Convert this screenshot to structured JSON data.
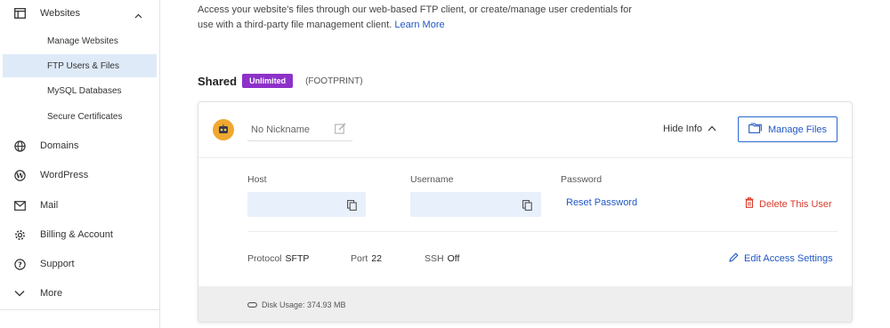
{
  "sidebar": {
    "section": {
      "label": "Websites",
      "icon": "websites-icon"
    },
    "sub_items": [
      {
        "label": "Manage Websites",
        "active": false
      },
      {
        "label": "FTP Users & Files",
        "active": true
      },
      {
        "label": "MySQL Databases",
        "active": false
      },
      {
        "label": "Secure Certificates",
        "active": false
      }
    ],
    "items": [
      {
        "label": "Domains",
        "icon": "globe-icon"
      },
      {
        "label": "WordPress",
        "icon": "wordpress-icon"
      },
      {
        "label": "Mail",
        "icon": "mail-icon"
      },
      {
        "label": "Billing & Account",
        "icon": "gear-icon"
      },
      {
        "label": "Support",
        "icon": "help-icon"
      },
      {
        "label": "More",
        "icon": "chevron-down-icon"
      }
    ]
  },
  "intro": {
    "text": "Access your website's files through our web-based FTP client, or create/manage user credentials for use with a third-party file management client.",
    "link": "Learn More"
  },
  "plan": {
    "title": "Shared",
    "badge": "Unlimited",
    "name": "(FOOTPRINT)"
  },
  "user": {
    "nickname_placeholder": "No Nickname",
    "hide_info": "Hide Info",
    "manage_files": "Manage Files",
    "host_label": "Host",
    "username_label": "Username",
    "password_label": "Password",
    "reset_password": "Reset Password",
    "delete_user": "Delete This User",
    "protocol_label": "Protocol",
    "protocol_value": "SFTP",
    "port_label": "Port",
    "port_value": "22",
    "ssh_label": "SSH",
    "ssh_value": "Off",
    "edit_access": "Edit Access Settings",
    "disk_usage": "Disk Usage: 374.93 MB"
  },
  "colors": {
    "accent": "#2157c4",
    "badge": "#8d31c9",
    "danger": "#d83a2a",
    "active_nav": "#dfeaf8"
  }
}
